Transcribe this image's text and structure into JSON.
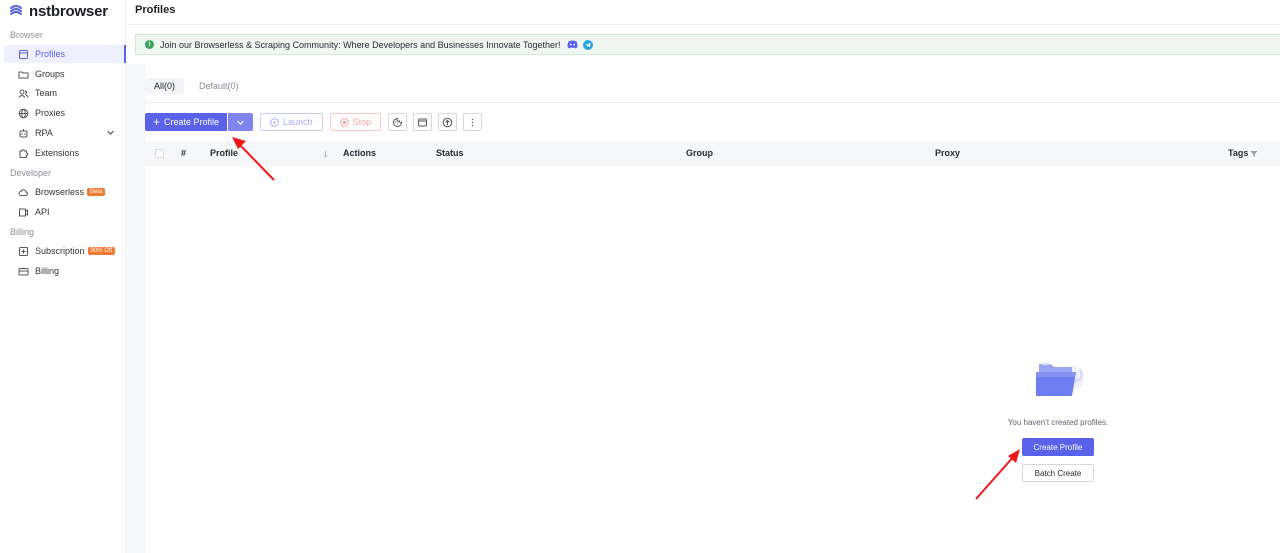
{
  "brand": {
    "name": "nstbrowser",
    "accent": "#5b61e8"
  },
  "sidebar": {
    "sections": [
      {
        "label": "Browser"
      },
      {
        "label": "Developer"
      },
      {
        "label": "Billing"
      }
    ],
    "items": [
      {
        "label": "Profiles",
        "icon": "profiles-icon"
      },
      {
        "label": "Groups",
        "icon": "folder-icon"
      },
      {
        "label": "Team",
        "icon": "team-icon"
      },
      {
        "label": "Proxies",
        "icon": "globe-icon"
      },
      {
        "label": "RPA",
        "icon": "robot-icon"
      },
      {
        "label": "Extensions",
        "icon": "puzzle-icon"
      },
      {
        "label": "Browserless",
        "icon": "cloud-icon",
        "badge": "Beta"
      },
      {
        "label": "API",
        "icon": "api-icon"
      },
      {
        "label": "Subscription",
        "icon": "subscription-icon",
        "badge": "90% Off"
      },
      {
        "label": "Billing",
        "icon": "card-icon"
      }
    ]
  },
  "header": {
    "title": "Profiles"
  },
  "banner": {
    "text": "Join our Browserless & Scraping Community: Where Developers and Businesses Innovate Together!",
    "info_glyph": "i"
  },
  "tabs": [
    {
      "label": "All(0)"
    },
    {
      "label": "Default(0)"
    }
  ],
  "toolbar": {
    "create_label": "Create Profile",
    "launch_label": "Launch",
    "stop_label": "Stop"
  },
  "table": {
    "columns": [
      "#",
      "Profile",
      "Actions",
      "Status",
      "Group",
      "Proxy",
      "Tags"
    ]
  },
  "empty_state": {
    "message": "You haven't created profiles.",
    "create_label": "Create Profile",
    "batch_label": "Batch Create"
  }
}
